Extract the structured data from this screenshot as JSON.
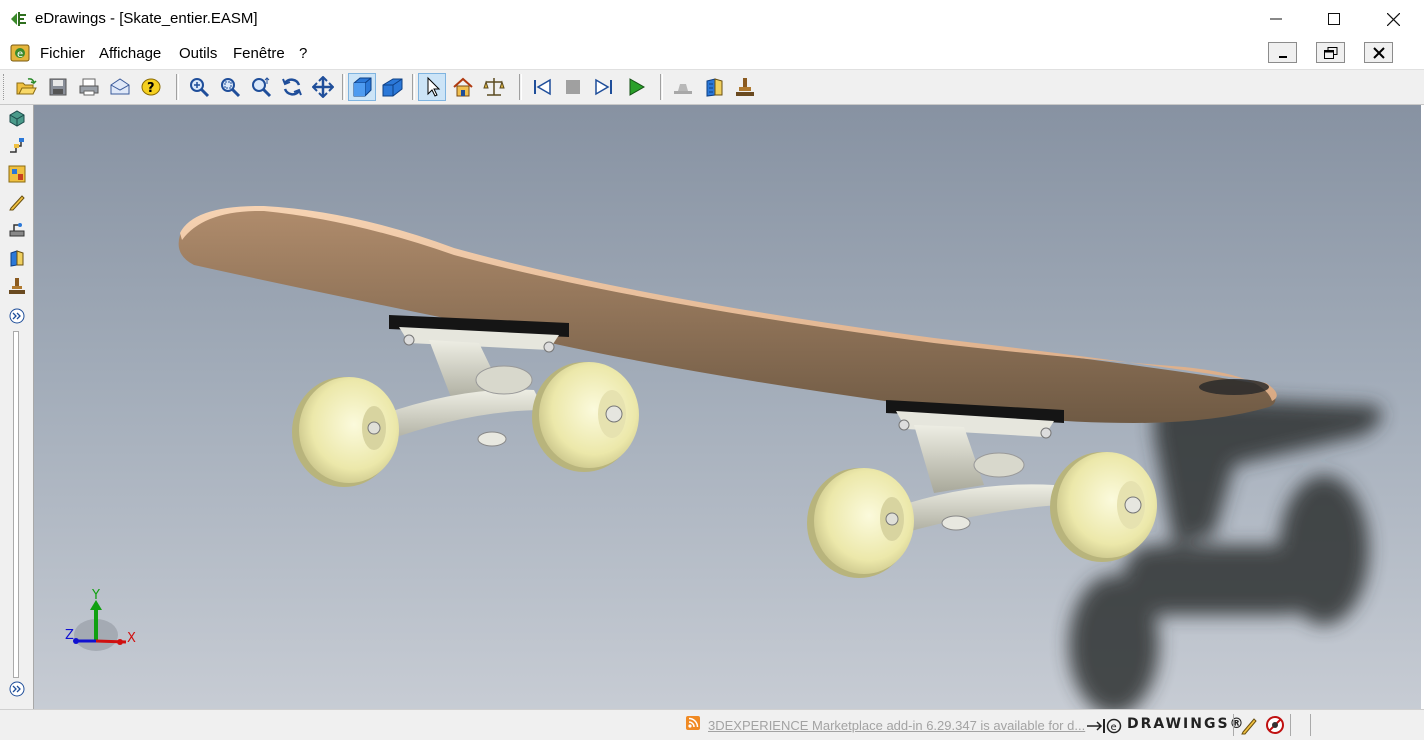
{
  "window": {
    "title": "eDrawings - [Skate_entier.EASM]",
    "controls": [
      "minimize",
      "maximize",
      "close"
    ]
  },
  "menu": {
    "items": [
      "Fichier",
      "Affichage",
      "Outils",
      "Fenêtre",
      "?"
    ]
  },
  "toolbar": {
    "groups": [
      [
        "open-icon",
        "save-icon",
        "print-icon",
        "send-email-icon",
        "help-icon"
      ],
      [
        "zoom-to-fit-icon",
        "zoom-to-area-icon",
        "zoom-in-out-icon",
        "rotate-icon",
        "pan-icon"
      ],
      [
        "shaded-icon",
        "perspective-icon"
      ],
      [
        "select-icon",
        "home-icon",
        "measure-icon"
      ],
      [
        "first-step-icon",
        "stop-icon",
        "next-step-icon",
        "play-icon"
      ],
      [
        "stamp-icon",
        "cross-section-icon",
        "markup-stamp-icon"
      ]
    ],
    "active": [
      "shaded-icon",
      "select-icon"
    ]
  },
  "left_panel": {
    "icons": [
      "components-icon",
      "configurations-icon",
      "sheets-icon",
      "markup-icon",
      "measure-panel-icon",
      "section-panel-icon",
      "stamp-panel-icon",
      "expand-icon"
    ]
  },
  "triad": {
    "x": "X",
    "y": "Y",
    "z": "Z"
  },
  "status": {
    "message": "3DEXPERIENCE Marketplace add-in 6.29.347 is available for d...",
    "brand": "DRAWINGS®"
  },
  "colors": {
    "viewport_top": "#8792a2",
    "viewport_bottom": "#c7ccd4",
    "deck": "#a8876a",
    "wheel": "#f0edb8",
    "truck": "#cfcfc3"
  }
}
